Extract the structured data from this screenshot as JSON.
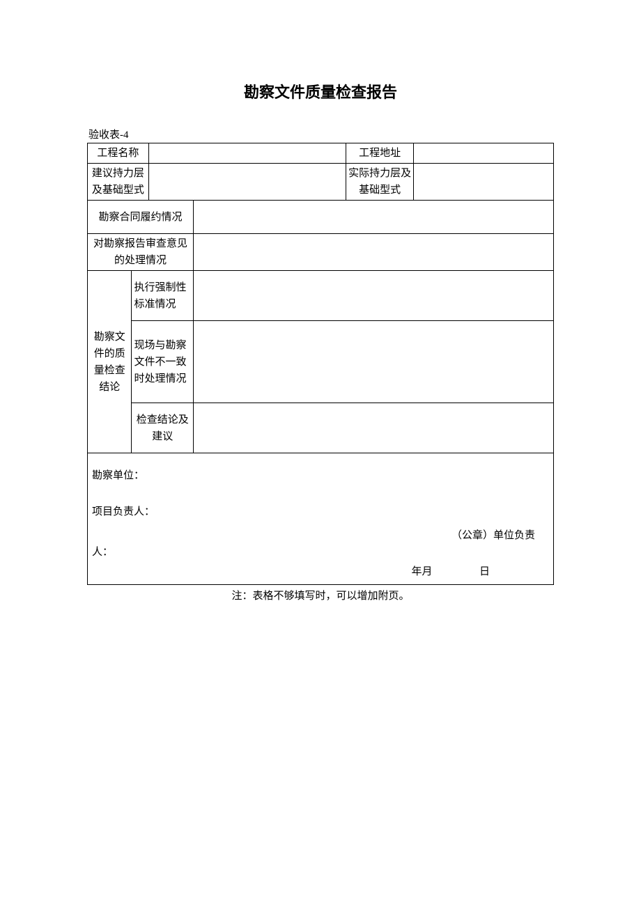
{
  "title": "勘察文件质量检查报告",
  "formNumber": "验收表-4",
  "rows": {
    "projectName": {
      "label": "工程名称",
      "value": ""
    },
    "projectAddress": {
      "label": "工程地址",
      "value": ""
    },
    "suggestedLayer": {
      "label": "建议持力层及基础型式",
      "value": ""
    },
    "actualLayer": {
      "label": "实际持力层及基础型式",
      "value": ""
    },
    "contractPerformance": {
      "label": "勘察合同履约情况",
      "value": ""
    },
    "reviewHandling": {
      "label": "对勘察报告审查意见的处理情况",
      "value": ""
    },
    "qualityConclusion": {
      "label": "勘察文件的质量检查结论",
      "sub": {
        "mandatoryStandards": {
          "label": "执行强制性标准情况",
          "value": ""
        },
        "inconsistency": {
          "label": "现场与勘察文件不一致时处理情况",
          "value": ""
        },
        "conclusionSuggestion": {
          "label": "检查结论及建议",
          "value": ""
        }
      }
    }
  },
  "footer": {
    "surveyUnitLabel": "勘察单位：",
    "projectLeaderLabel": "项目负责人：",
    "sealLabel": "（公章）单位负责",
    "personSuffix": "人：",
    "yearMonth": "年月",
    "day": "日"
  },
  "note": "注：表格不够填写时，可以增加附页。"
}
